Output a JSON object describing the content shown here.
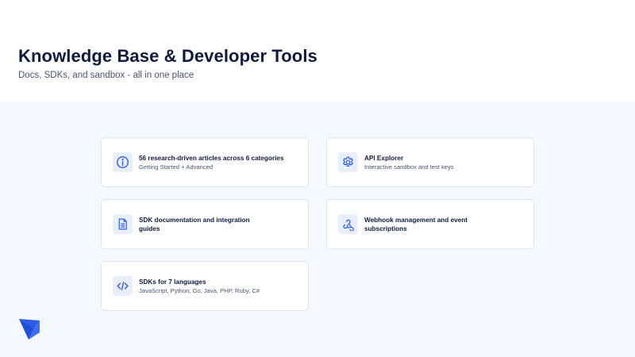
{
  "header": {
    "title": "Knowledge Base & Developer Tools",
    "subtitle": "Docs, SDKs, and sandbox - all in one place"
  },
  "cards": [
    {
      "icon": "info-icon",
      "title": "56 research-driven articles across 6 categories",
      "subtitle": "Getting Started + Advanced"
    },
    {
      "icon": "gear-icon",
      "title": "API Explorer",
      "subtitle": "Interactive sandbox and test keys"
    },
    {
      "icon": "document-icon",
      "title": "SDK documentation and integration guides",
      "subtitle": ""
    },
    {
      "icon": "webhook-icon",
      "title": "Webhook management and event subscriptions",
      "subtitle": ""
    },
    {
      "icon": "code-icon",
      "title": "SDKs for 7 languages",
      "subtitle": "JavaScript, Python, Go, Java, PHP, Ruby, C#"
    }
  ],
  "logo": {
    "icon": "brand-logo-icon"
  },
  "colors": {
    "accent": "#2b5bea",
    "background": "#f5f8fe",
    "title": "#0f1b3d",
    "muted": "#4a5573",
    "icon_bg": "#e8eefc"
  }
}
